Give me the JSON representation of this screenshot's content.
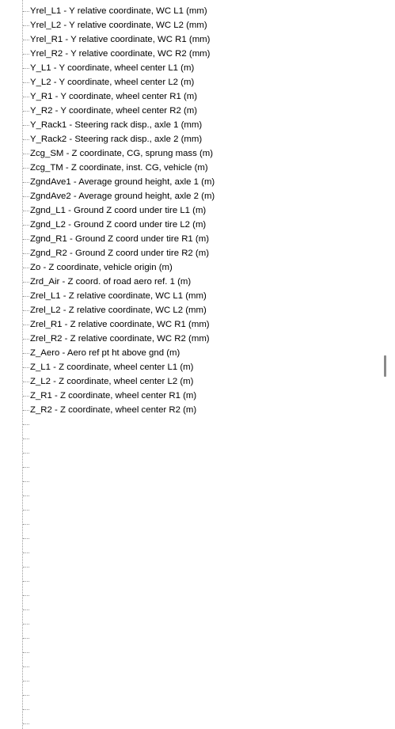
{
  "tree": {
    "items": [
      {
        "label": "Yrel_L1 - Y relative coordinate, WC L1 (mm)"
      },
      {
        "label": "Yrel_L2 - Y relative coordinate, WC L2 (mm)"
      },
      {
        "label": "Yrel_R1 - Y relative coordinate, WC R1 (mm)"
      },
      {
        "label": "Yrel_R2 - Y relative coordinate, WC R2 (mm)"
      },
      {
        "label": "Y_L1 - Y coordinate, wheel center L1 (m)"
      },
      {
        "label": "Y_L2 - Y coordinate, wheel center L2 (m)"
      },
      {
        "label": "Y_R1 - Y coordinate, wheel center R1 (m)"
      },
      {
        "label": "Y_R2 - Y coordinate, wheel center R2 (m)"
      },
      {
        "label": "Y_Rack1 - Steering rack disp., axle 1 (mm)"
      },
      {
        "label": "Y_Rack2 - Steering rack disp., axle 2 (mm)"
      },
      {
        "label": "Zcg_SM - Z coordinate, CG, sprung mass (m)"
      },
      {
        "label": "Zcg_TM - Z coordinate, inst. CG, vehicle (m)"
      },
      {
        "label": "ZgndAve1 - Average ground height, axle 1 (m)"
      },
      {
        "label": "ZgndAve2 - Average ground height, axle 2 (m)"
      },
      {
        "label": "Zgnd_L1 - Ground Z coord under tire L1 (m)"
      },
      {
        "label": "Zgnd_L2 - Ground Z coord under tire L2 (m)"
      },
      {
        "label": "Zgnd_R1 - Ground Z coord under tire R1 (m)"
      },
      {
        "label": "Zgnd_R2 - Ground Z coord under tire R2 (m)"
      },
      {
        "label": "Zo - Z coordinate, vehicle origin (m)"
      },
      {
        "label": "Zrd_Air - Z coord. of road aero ref. 1 (m)"
      },
      {
        "label": "Zrel_L1 - Z relative coordinate, WC L1 (mm)"
      },
      {
        "label": "Zrel_L2 - Z relative coordinate, WC L2 (mm)"
      },
      {
        "label": "Zrel_R1 - Z relative coordinate, WC R1 (mm)"
      },
      {
        "label": "Zrel_R2 - Z relative coordinate, WC R2 (mm)"
      },
      {
        "label": "Z_Aero - Aero ref pt ht above gnd (m)"
      },
      {
        "label": "Z_L1 - Z coordinate, wheel center L1 (m)"
      },
      {
        "label": "Z_L2 - Z coordinate, wheel center L2 (m)"
      },
      {
        "label": "Z_R1 - Z coordinate, wheel center R1 (m)"
      },
      {
        "label": "Z_R2 - Z coordinate, wheel center R2 (m)"
      }
    ],
    "empty_rows": [
      0,
      1,
      2,
      3,
      4,
      5,
      6,
      7,
      8,
      9,
      10,
      11,
      12,
      13,
      14,
      15,
      16,
      17,
      18,
      19,
      20,
      21
    ]
  },
  "colors": {
    "text": "#000000",
    "background": "#ffffff",
    "guide_lines": "#9a9a9a",
    "scroll_thumb": "#8a8a8a"
  }
}
